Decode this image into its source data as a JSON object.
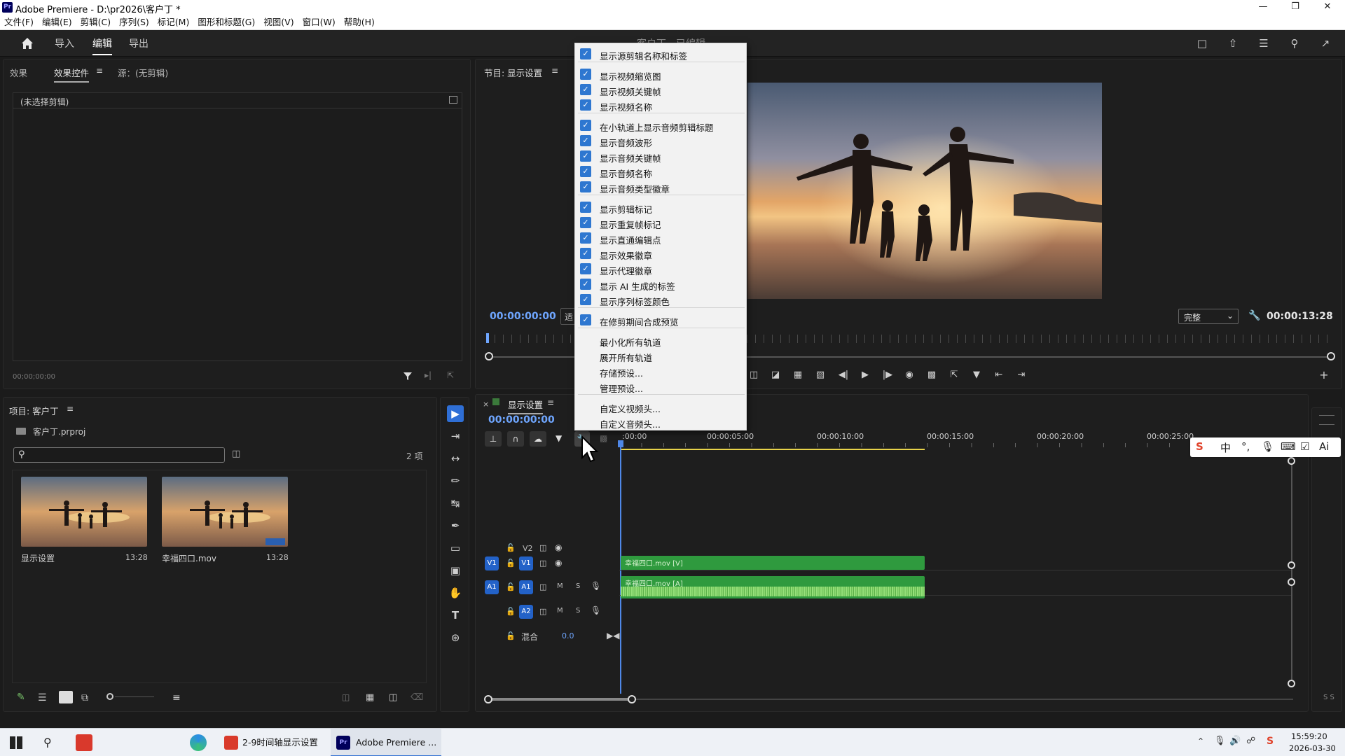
{
  "window": {
    "title": "Adobe Premiere - D:\\pr2026\\客户丁 *",
    "app_icon_text": "Pr"
  },
  "menu": [
    "文件(F)",
    "编辑(E)",
    "剪辑(C)",
    "序列(S)",
    "标记(M)",
    "图形和标题(G)",
    "视图(V)",
    "窗口(W)",
    "帮助(H)"
  ],
  "workspace": {
    "tabs": [
      "导入",
      "编辑",
      "导出"
    ],
    "active_tab": "编辑",
    "center_title": "客户丁 - 已编辑"
  },
  "effects_panel": {
    "tabs": [
      "效果",
      "效果控件",
      "源：(无剪辑)"
    ],
    "no_clip": "(未选择剪辑)",
    "timecode": "00;00;00;00"
  },
  "project": {
    "title": "项目: 客户丁",
    "file": "客户丁.prproj",
    "search_placeholder": "",
    "item_count": "2 项",
    "items": [
      {
        "name": "显示设置",
        "duration": "13:28"
      },
      {
        "name": "幸福四口.mov",
        "duration": "13:28"
      }
    ]
  },
  "program_monitor": {
    "title": "节目: 显示设置",
    "timecode_left": "00:00:00:00",
    "fit_partial": "适",
    "quality": "完整",
    "timecode_right": "00:00:13:28"
  },
  "timeline": {
    "sequence_name": "显示设置",
    "timecode": "00:00:00:00",
    "ruler_labels": [
      ":00:00",
      "00:00:05:00",
      "00:00:10:00",
      "00:00:15:00",
      "00:00:20:00",
      "00:00:25:00"
    ],
    "tracks": {
      "v2": "V2",
      "v1": "V1",
      "a1": "A1",
      "a2": "A2",
      "mix_label": "混合",
      "mix_value": "0.0",
      "m": "M",
      "s": "S"
    },
    "clips": {
      "video": "幸福四口.mov [V]",
      "audio": "幸福四口.mov [A]"
    },
    "right_meter_label": "S S"
  },
  "context_menu": {
    "groups": [
      [
        {
          "label": "显示源剪辑名称和标签",
          "checked": true
        }
      ],
      [
        {
          "label": "显示视频缩览图",
          "checked": true
        },
        {
          "label": "显示视频关键帧",
          "checked": true
        },
        {
          "label": "显示视频名称",
          "checked": true
        }
      ],
      [
        {
          "label": "在小轨道上显示音频剪辑标题",
          "checked": true
        },
        {
          "label": "显示音频波形",
          "checked": true
        },
        {
          "label": "显示音频关键帧",
          "checked": true
        },
        {
          "label": "显示音频名称",
          "checked": true
        },
        {
          "label": "显示音频类型徽章",
          "checked": true
        }
      ],
      [
        {
          "label": "显示剪辑标记",
          "checked": true
        },
        {
          "label": "显示重复帧标记",
          "checked": true
        },
        {
          "label": "显示直通编辑点",
          "checked": true
        },
        {
          "label": "显示效果徽章",
          "checked": true
        },
        {
          "label": "显示代理徽章",
          "checked": true
        },
        {
          "label": "显示 AI 生成的标签",
          "checked": true
        },
        {
          "label": "显示序列标签颜色",
          "checked": true
        }
      ],
      [
        {
          "label": "在修剪期间合成预览",
          "checked": true
        }
      ],
      [
        {
          "label": "最小化所有轨道",
          "checked": false
        },
        {
          "label": "展开所有轨道",
          "checked": false
        },
        {
          "label": "存储预设...",
          "checked": false
        },
        {
          "label": "管理预设...",
          "checked": false
        }
      ],
      [
        {
          "label": "自定义视频头...",
          "checked": false
        },
        {
          "label": "自定义音频头...",
          "checked": false
        }
      ]
    ]
  },
  "ime": {
    "items": [
      "中",
      "Ai"
    ]
  },
  "taskbar": {
    "apps": [
      "2-9时间轴显示设置",
      "Adobe Premiere ..."
    ],
    "time": "15:59:20",
    "date": "2026-03-30"
  },
  "colors": {
    "accent_blue": "#2362c8",
    "timecode_blue": "#6fa6ff",
    "clip_green": "#2f9a3e",
    "audio_wave": "#86d06e",
    "menu_check": "#2e77d0"
  }
}
